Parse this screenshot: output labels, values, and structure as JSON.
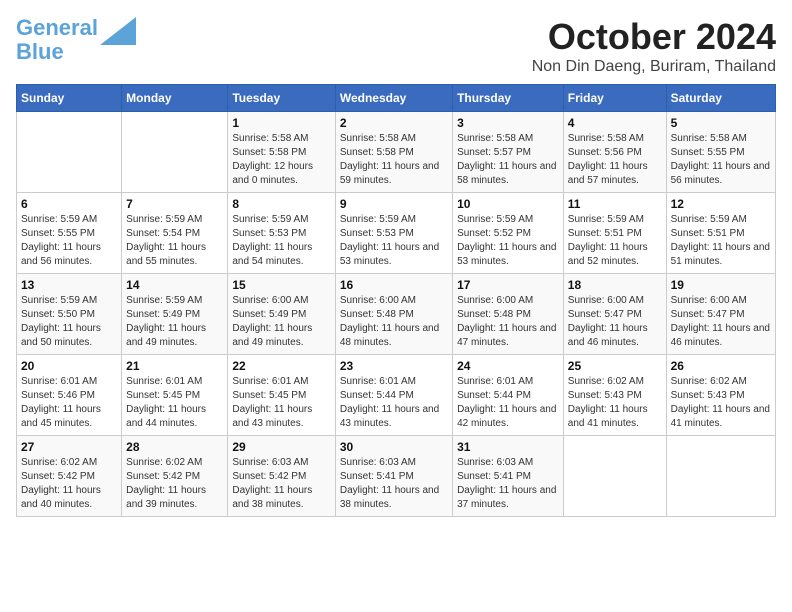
{
  "header": {
    "logo_line1": "General",
    "logo_line2": "Blue",
    "month": "October 2024",
    "location": "Non Din Daeng, Buriram, Thailand"
  },
  "weekdays": [
    "Sunday",
    "Monday",
    "Tuesday",
    "Wednesday",
    "Thursday",
    "Friday",
    "Saturday"
  ],
  "weeks": [
    [
      {
        "day": "",
        "sunrise": "",
        "sunset": "",
        "daylight": ""
      },
      {
        "day": "",
        "sunrise": "",
        "sunset": "",
        "daylight": ""
      },
      {
        "day": "1",
        "sunrise": "Sunrise: 5:58 AM",
        "sunset": "Sunset: 5:58 PM",
        "daylight": "Daylight: 12 hours and 0 minutes."
      },
      {
        "day": "2",
        "sunrise": "Sunrise: 5:58 AM",
        "sunset": "Sunset: 5:58 PM",
        "daylight": "Daylight: 11 hours and 59 minutes."
      },
      {
        "day": "3",
        "sunrise": "Sunrise: 5:58 AM",
        "sunset": "Sunset: 5:57 PM",
        "daylight": "Daylight: 11 hours and 58 minutes."
      },
      {
        "day": "4",
        "sunrise": "Sunrise: 5:58 AM",
        "sunset": "Sunset: 5:56 PM",
        "daylight": "Daylight: 11 hours and 57 minutes."
      },
      {
        "day": "5",
        "sunrise": "Sunrise: 5:58 AM",
        "sunset": "Sunset: 5:55 PM",
        "daylight": "Daylight: 11 hours and 56 minutes."
      }
    ],
    [
      {
        "day": "6",
        "sunrise": "Sunrise: 5:59 AM",
        "sunset": "Sunset: 5:55 PM",
        "daylight": "Daylight: 11 hours and 56 minutes."
      },
      {
        "day": "7",
        "sunrise": "Sunrise: 5:59 AM",
        "sunset": "Sunset: 5:54 PM",
        "daylight": "Daylight: 11 hours and 55 minutes."
      },
      {
        "day": "8",
        "sunrise": "Sunrise: 5:59 AM",
        "sunset": "Sunset: 5:53 PM",
        "daylight": "Daylight: 11 hours and 54 minutes."
      },
      {
        "day": "9",
        "sunrise": "Sunrise: 5:59 AM",
        "sunset": "Sunset: 5:53 PM",
        "daylight": "Daylight: 11 hours and 53 minutes."
      },
      {
        "day": "10",
        "sunrise": "Sunrise: 5:59 AM",
        "sunset": "Sunset: 5:52 PM",
        "daylight": "Daylight: 11 hours and 53 minutes."
      },
      {
        "day": "11",
        "sunrise": "Sunrise: 5:59 AM",
        "sunset": "Sunset: 5:51 PM",
        "daylight": "Daylight: 11 hours and 52 minutes."
      },
      {
        "day": "12",
        "sunrise": "Sunrise: 5:59 AM",
        "sunset": "Sunset: 5:51 PM",
        "daylight": "Daylight: 11 hours and 51 minutes."
      }
    ],
    [
      {
        "day": "13",
        "sunrise": "Sunrise: 5:59 AM",
        "sunset": "Sunset: 5:50 PM",
        "daylight": "Daylight: 11 hours and 50 minutes."
      },
      {
        "day": "14",
        "sunrise": "Sunrise: 5:59 AM",
        "sunset": "Sunset: 5:49 PM",
        "daylight": "Daylight: 11 hours and 49 minutes."
      },
      {
        "day": "15",
        "sunrise": "Sunrise: 6:00 AM",
        "sunset": "Sunset: 5:49 PM",
        "daylight": "Daylight: 11 hours and 49 minutes."
      },
      {
        "day": "16",
        "sunrise": "Sunrise: 6:00 AM",
        "sunset": "Sunset: 5:48 PM",
        "daylight": "Daylight: 11 hours and 48 minutes."
      },
      {
        "day": "17",
        "sunrise": "Sunrise: 6:00 AM",
        "sunset": "Sunset: 5:48 PM",
        "daylight": "Daylight: 11 hours and 47 minutes."
      },
      {
        "day": "18",
        "sunrise": "Sunrise: 6:00 AM",
        "sunset": "Sunset: 5:47 PM",
        "daylight": "Daylight: 11 hours and 46 minutes."
      },
      {
        "day": "19",
        "sunrise": "Sunrise: 6:00 AM",
        "sunset": "Sunset: 5:47 PM",
        "daylight": "Daylight: 11 hours and 46 minutes."
      }
    ],
    [
      {
        "day": "20",
        "sunrise": "Sunrise: 6:01 AM",
        "sunset": "Sunset: 5:46 PM",
        "daylight": "Daylight: 11 hours and 45 minutes."
      },
      {
        "day": "21",
        "sunrise": "Sunrise: 6:01 AM",
        "sunset": "Sunset: 5:45 PM",
        "daylight": "Daylight: 11 hours and 44 minutes."
      },
      {
        "day": "22",
        "sunrise": "Sunrise: 6:01 AM",
        "sunset": "Sunset: 5:45 PM",
        "daylight": "Daylight: 11 hours and 43 minutes."
      },
      {
        "day": "23",
        "sunrise": "Sunrise: 6:01 AM",
        "sunset": "Sunset: 5:44 PM",
        "daylight": "Daylight: 11 hours and 43 minutes."
      },
      {
        "day": "24",
        "sunrise": "Sunrise: 6:01 AM",
        "sunset": "Sunset: 5:44 PM",
        "daylight": "Daylight: 11 hours and 42 minutes."
      },
      {
        "day": "25",
        "sunrise": "Sunrise: 6:02 AM",
        "sunset": "Sunset: 5:43 PM",
        "daylight": "Daylight: 11 hours and 41 minutes."
      },
      {
        "day": "26",
        "sunrise": "Sunrise: 6:02 AM",
        "sunset": "Sunset: 5:43 PM",
        "daylight": "Daylight: 11 hours and 41 minutes."
      }
    ],
    [
      {
        "day": "27",
        "sunrise": "Sunrise: 6:02 AM",
        "sunset": "Sunset: 5:42 PM",
        "daylight": "Daylight: 11 hours and 40 minutes."
      },
      {
        "day": "28",
        "sunrise": "Sunrise: 6:02 AM",
        "sunset": "Sunset: 5:42 PM",
        "daylight": "Daylight: 11 hours and 39 minutes."
      },
      {
        "day": "29",
        "sunrise": "Sunrise: 6:03 AM",
        "sunset": "Sunset: 5:42 PM",
        "daylight": "Daylight: 11 hours and 38 minutes."
      },
      {
        "day": "30",
        "sunrise": "Sunrise: 6:03 AM",
        "sunset": "Sunset: 5:41 PM",
        "daylight": "Daylight: 11 hours and 38 minutes."
      },
      {
        "day": "31",
        "sunrise": "Sunrise: 6:03 AM",
        "sunset": "Sunset: 5:41 PM",
        "daylight": "Daylight: 11 hours and 37 minutes."
      },
      {
        "day": "",
        "sunrise": "",
        "sunset": "",
        "daylight": ""
      },
      {
        "day": "",
        "sunrise": "",
        "sunset": "",
        "daylight": ""
      }
    ]
  ]
}
